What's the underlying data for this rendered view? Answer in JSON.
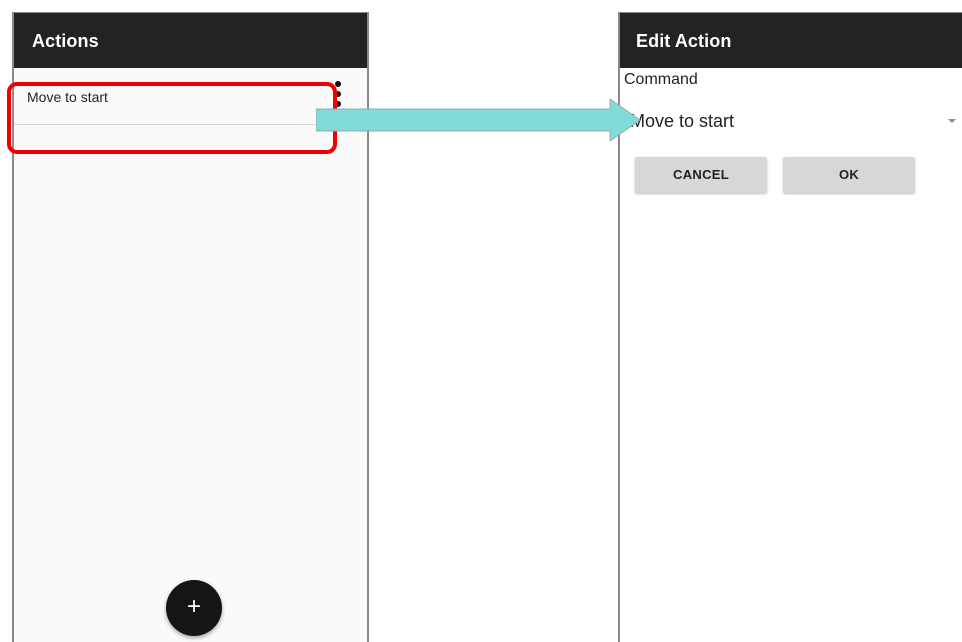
{
  "left_screen": {
    "title": "Actions",
    "list_items": [
      {
        "label": "Move to start"
      }
    ],
    "overflow_icon": "more-vert-icon",
    "fab_label": "+"
  },
  "right_screen": {
    "title": "Edit Action",
    "command_label": "Command",
    "command_value": "Move to start",
    "cancel_label": "CANCEL",
    "ok_label": "OK"
  },
  "annotation": {
    "highlight_color": "#ee0000",
    "arrow_color": "#7fdcd8"
  }
}
